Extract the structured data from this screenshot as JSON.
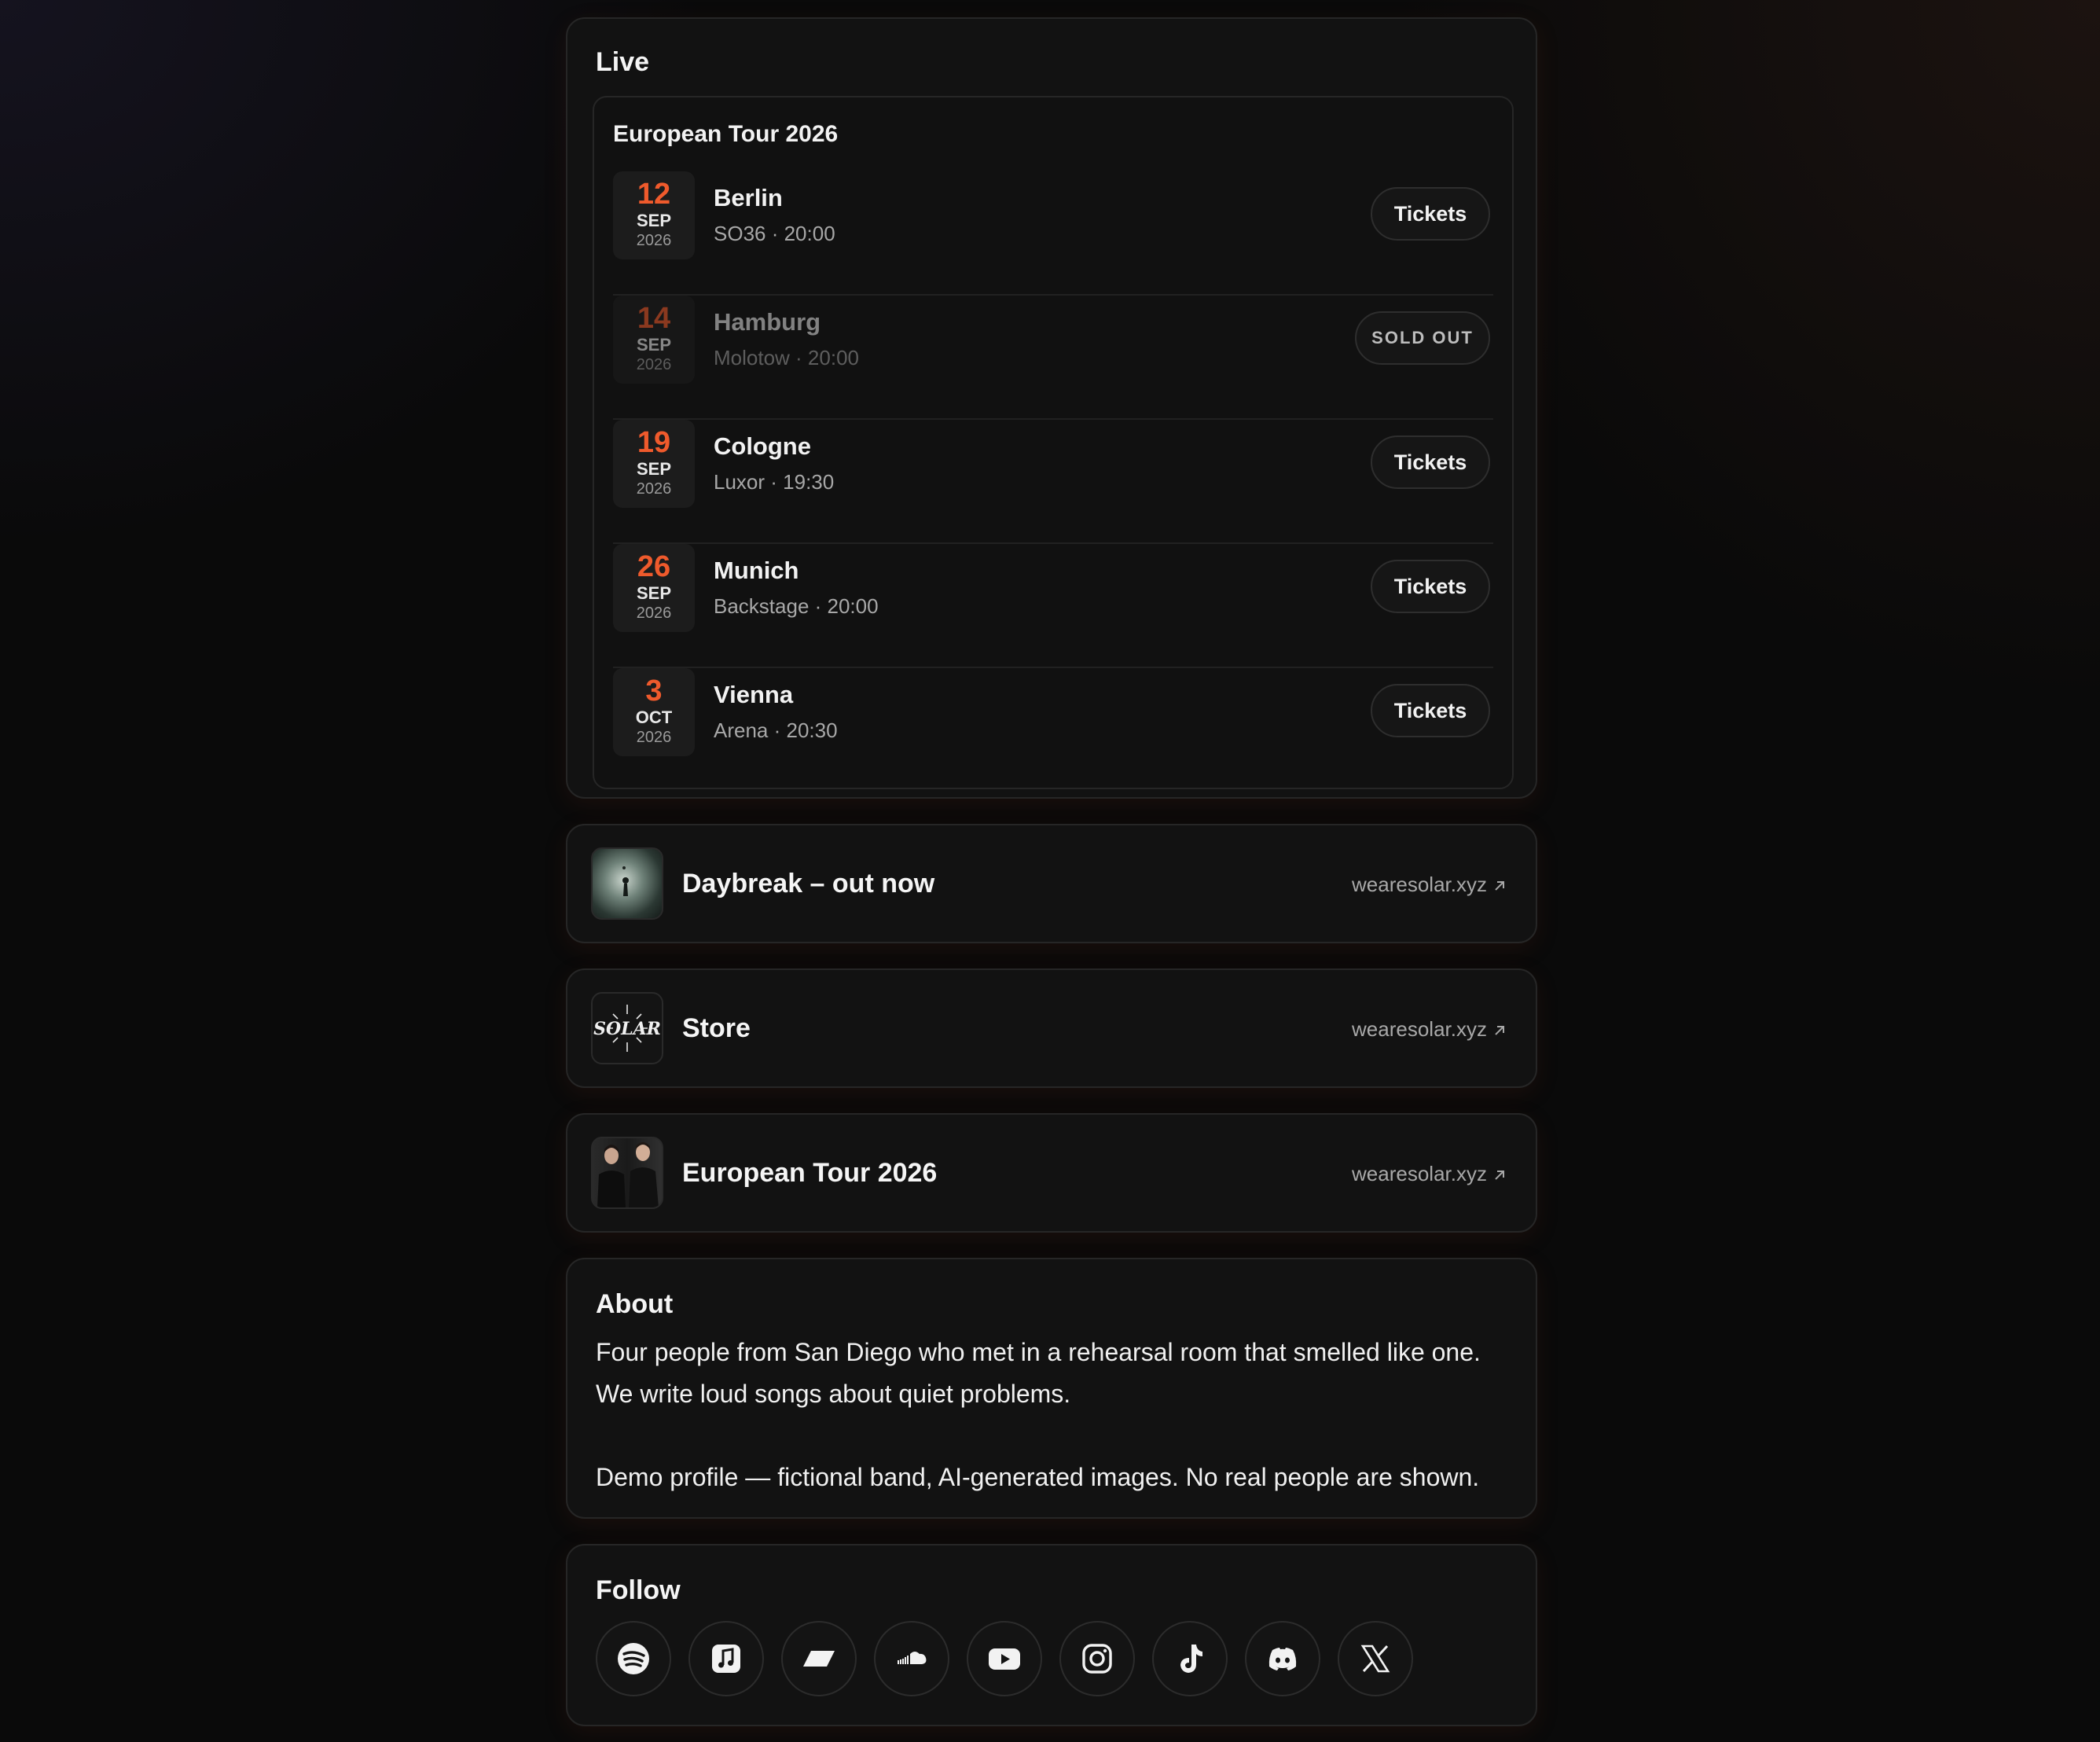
{
  "live": {
    "title": "Live",
    "tour_name": "European Tour 2026",
    "events": [
      {
        "day": "12",
        "month": "SEP",
        "year": "2026",
        "city": "Berlin",
        "venue": "SO36 · 20:00",
        "action": "Tickets",
        "sold_out": false
      },
      {
        "day": "14",
        "month": "SEP",
        "year": "2026",
        "city": "Hamburg",
        "venue": "Molotow · 20:00",
        "action": "SOLD OUT",
        "sold_out": true
      },
      {
        "day": "19",
        "month": "SEP",
        "year": "2026",
        "city": "Cologne",
        "venue": "Luxor · 19:30",
        "action": "Tickets",
        "sold_out": false
      },
      {
        "day": "26",
        "month": "SEP",
        "year": "2026",
        "city": "Munich",
        "venue": "Backstage · 20:00",
        "action": "Tickets",
        "sold_out": false
      },
      {
        "day": "3",
        "month": "OCT",
        "year": "2026",
        "city": "Vienna",
        "venue": "Arena · 20:30",
        "action": "Tickets",
        "sold_out": false
      }
    ]
  },
  "links": [
    {
      "title": "Daybreak – out now",
      "url": "wearesolar.xyz",
      "thumb": "album-cover"
    },
    {
      "title": "Store",
      "url": "wearesolar.xyz",
      "thumb": "solar-logo",
      "logo_text": "SOLAR"
    },
    {
      "title": "European Tour 2026",
      "url": "wearesolar.xyz",
      "thumb": "band-photo"
    }
  ],
  "about": {
    "title": "About",
    "paragraph_1": "Four people from San Diego who met in a rehearsal room that smelled like one. We write loud songs about quiet problems.",
    "paragraph_2": "Demo profile — fictional band, AI-generated images. No real people are shown."
  },
  "follow": {
    "title": "Follow",
    "icons": [
      "spotify-icon",
      "apple-music-icon",
      "bandcamp-icon",
      "soundcloud-icon",
      "youtube-icon",
      "instagram-icon",
      "tiktok-icon",
      "discord-icon",
      "x-icon"
    ]
  },
  "colors": {
    "accent": "#ef5a2c",
    "card_bg": "#121212",
    "border": "#262626",
    "page_bg": "#0a0a0a"
  }
}
